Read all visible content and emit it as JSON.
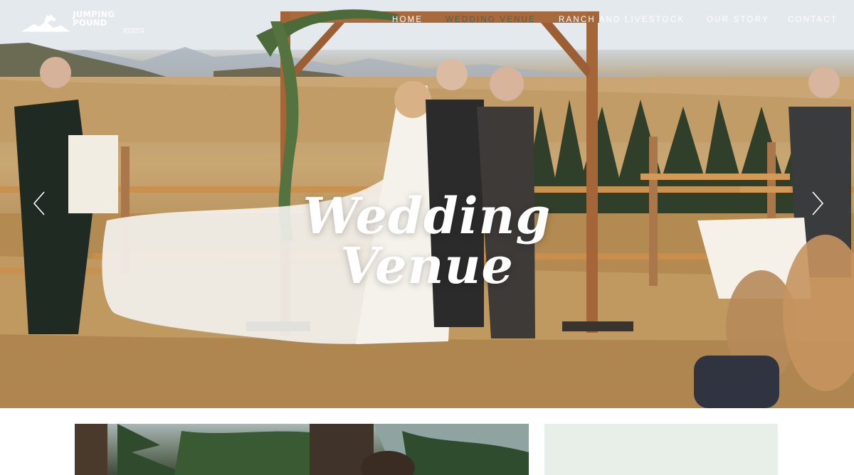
{
  "brand": {
    "name_line1": "JUMPING POUND",
    "name_line2": "RANCH",
    "logo_icon": "horse-rider-mountain-icon"
  },
  "nav": {
    "items": [
      {
        "label": "HOME",
        "active": false
      },
      {
        "label": "WEDDING VENUE",
        "active": true
      },
      {
        "label": "RANCH AND LIVESTOCK",
        "active": false
      },
      {
        "label": "OUR STORY",
        "active": false
      },
      {
        "label": "CONTACT",
        "active": false
      }
    ]
  },
  "hero": {
    "title": "Wedding Venue",
    "prev_icon": "chevron-left-icon",
    "next_icon": "chevron-right-icon"
  },
  "colors": {
    "nav_text": "#ffffff",
    "nav_active": "#40624a",
    "panel_bg": "#e7efe8"
  }
}
